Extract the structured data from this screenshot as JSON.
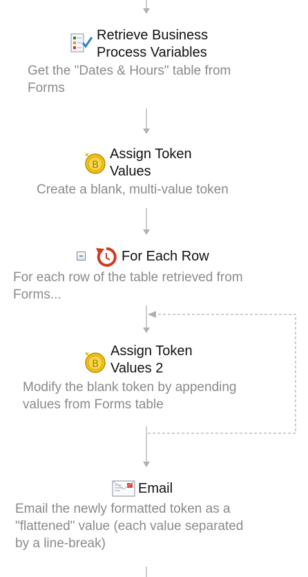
{
  "steps": [
    {
      "icon": "retrieve-variables-icon",
      "title_line1": "Retrieve Business",
      "title_line2": "Process Variables",
      "desc_line1": "Get the \"Dates & Hours\" table from",
      "desc_line2": "Forms"
    },
    {
      "icon": "token-coin-icon",
      "title_line1": "Assign Token",
      "title_line2": "Values",
      "desc_line1": "Create a blank, multi-value token"
    },
    {
      "icon": "loop-icon",
      "collapse_icon": "collapse-minus-icon",
      "title_line1": "For Each Row",
      "desc_line1": "For each row of the table retrieved from",
      "desc_line2": "Forms..."
    },
    {
      "icon": "token-coin-icon",
      "title_line1": "Assign Token",
      "title_line2": "Values 2",
      "desc_line1": "Modify the blank token by appending",
      "desc_line2": "values from Forms table"
    },
    {
      "icon": "email-icon",
      "title_line1": "Email",
      "desc_line1": "Email the newly formatted token as a",
      "desc_line2": "\"flattened\" value (each value separated",
      "desc_line3": "by a line-break)"
    }
  ],
  "colors": {
    "connector": "#b0b0b0",
    "title": "#111111",
    "description": "#8a8a8a",
    "background": "#ffffff"
  }
}
